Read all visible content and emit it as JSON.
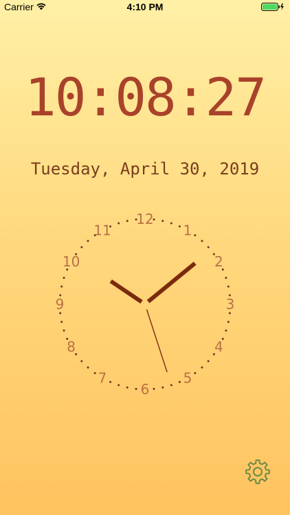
{
  "status_bar": {
    "carrier": "Carrier",
    "time": "4:10 PM",
    "battery_color": "#4cd964"
  },
  "clock": {
    "digital_time": "10:08:27",
    "date": "Tuesday, April 30, 2019",
    "hour": 10,
    "minute": 8,
    "second": 27,
    "numbers": [
      "12",
      "1",
      "2",
      "3",
      "4",
      "5",
      "6",
      "7",
      "8",
      "9",
      "10",
      "11"
    ],
    "digital_color": "#a9422a",
    "hand_color": "#7b2a0e",
    "number_color": "#b97045"
  },
  "settings": {
    "icon": "gear-icon",
    "color": "#6c8a49"
  }
}
